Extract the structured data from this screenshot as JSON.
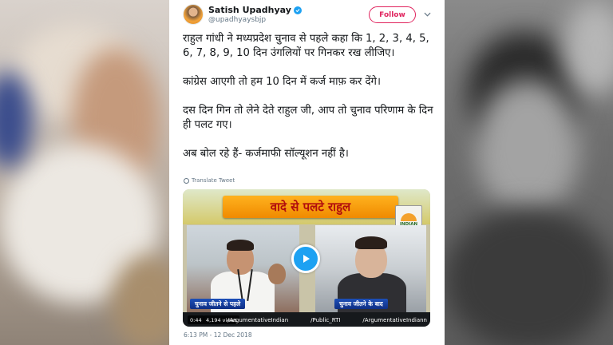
{
  "tweet": {
    "display_name": "Satish Upadhyay",
    "handle": "@upadhyaysbjp",
    "follow_label": "Follow",
    "paragraphs": [
      "राहुल गांधी ने मध्यप्रदेश चुनाव से पहले कहा कि 1, 2, 3, 4, 5, 6, 7, 8, 9, 10 दिन उंगलियों पर गिनकर  रख लीजिए।",
      "कांग्रेस आएगी तो हम 10 दिन में कर्ज माफ़ कर देंगे।",
      "दस दिन गिन तो लेने देते राहुल जी, आप तो चुनाव परिणाम के दिन ही पलट गए।",
      "अब बोल रहे हैं- कर्जमाफी सॉल्यूशन नहीं है।"
    ],
    "translate_label": "Translate Tweet",
    "timestamp": "6:13 PM - 12 Dec 2018"
  },
  "video": {
    "banner_text": "वादे से पलटे राहुल",
    "logo_text": "INDIAN",
    "caption_left": "चुनाव जीतने से पहले",
    "caption_right": "चुनाव जीतने के बाद",
    "duration": "0:44",
    "views": "4,194 views",
    "source_handles": [
      "/ArgumentativeIndian",
      "/Public_RTI",
      "/ArgumentativeIndiann"
    ],
    "play_color": "#1da1f2"
  },
  "colors": {
    "follow_accent": "#e0245e",
    "verified": "#1da1f2",
    "meta_gray": "#657786"
  }
}
